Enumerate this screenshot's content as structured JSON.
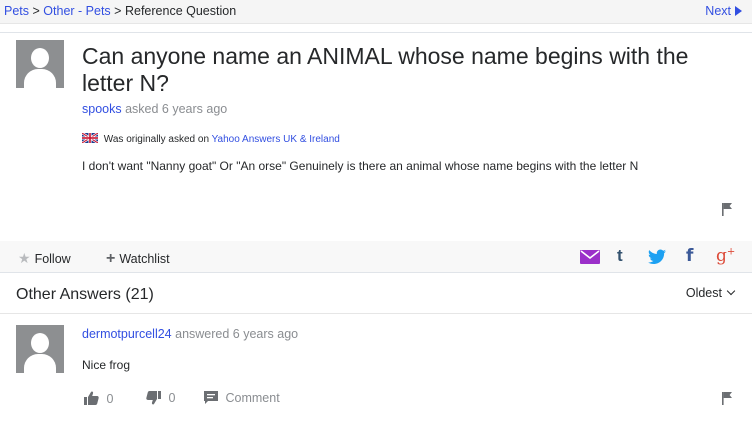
{
  "breadcrumb": {
    "items": [
      "Pets",
      "Other - Pets"
    ],
    "current": "Reference Question",
    "separator": ">"
  },
  "nav": {
    "next_label": "Next"
  },
  "question": {
    "title": "Can anyone name an ANIMAL whose name begins with the letter N?",
    "author": "spooks",
    "asked_text": "asked 6 years ago",
    "origin_prefix": "Was originally asked on",
    "origin_site": "Yahoo Answers UK & Ireland",
    "body": "I don't want \"Nanny goat\" Or \"An orse\" Genuinely is there an animal whose name begins with the letter N"
  },
  "actions": {
    "follow_label": "Follow",
    "watchlist_label": "Watchlist"
  },
  "share_icons": [
    {
      "name": "mail-icon",
      "glyph": "✉",
      "color": "#9b30c9"
    },
    {
      "name": "tumblr-icon",
      "glyph": "t",
      "color": "#34526f"
    },
    {
      "name": "twitter-icon",
      "glyph": "🐦",
      "color": "#1da1f2"
    },
    {
      "name": "facebook-icon",
      "glyph": "f",
      "color": "#3b5998"
    },
    {
      "name": "google-plus-icon",
      "glyph": "g+",
      "color": "#dd4b39"
    }
  ],
  "answers": {
    "header": "Other Answers (21)",
    "sort_label": "Oldest",
    "items": [
      {
        "author": "dermotpurcell24",
        "answered_text": "answered 6 years ago",
        "body": "Nice frog",
        "upvotes": "0",
        "downvotes": "0",
        "comment_label": "Comment"
      }
    ]
  },
  "colors": {
    "link": "#324fe1",
    "muted": "#8a8d91",
    "text": "#26282a"
  }
}
